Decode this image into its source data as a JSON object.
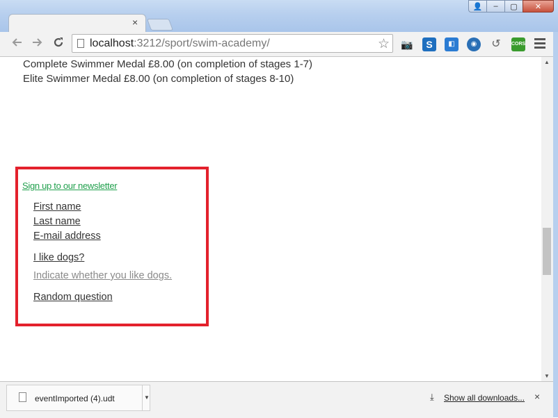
{
  "window": {
    "tab_close": "×",
    "controls": {
      "user": "👤",
      "minimize": "‒",
      "maximize": "▢",
      "close": "✕"
    }
  },
  "toolbar": {
    "back_icon": "back-arrow-icon",
    "forward_icon": "forward-arrow-icon",
    "reload_icon": "reload-icon",
    "url_host": "localhost",
    "url_rest": ":3212/sport/swim-academy/",
    "star": "☆",
    "extensions": [
      {
        "name": "camera-extension-icon",
        "color": "#333333",
        "glyph": "📷"
      },
      {
        "name": "s-extension-icon",
        "color": "#1f6fbf",
        "glyph": "S"
      },
      {
        "name": "tag-extension-icon",
        "color": "#2b7cd3",
        "glyph": "◧"
      },
      {
        "name": "globe-extension-icon",
        "color": "#2a6fb5",
        "glyph": "◉"
      },
      {
        "name": "history-extension-icon",
        "color": "#666666",
        "glyph": "↺"
      },
      {
        "name": "cors-extension-icon",
        "color": "#3a9b2e",
        "glyph": "CORS"
      }
    ]
  },
  "content": {
    "medals": [
      "Complete Swimmer Medal £8.00 (on completion of stages 1-7)",
      "Elite Swimmer Medal £8.00 (on completion of stages 8-10)"
    ],
    "newsletter_link": "Sign up to our newsletter",
    "form": {
      "first_name": "First name",
      "last_name": "Last name",
      "email": "E-mail address",
      "dogs_question": "I like dogs?",
      "dogs_hint": "Indicate whether you like dogs.",
      "random_question": "Random question"
    },
    "highlight_color": "#e3212c"
  },
  "downloads": {
    "file_name": "eventImported (4).udt",
    "show_all": "Show all downloads...",
    "close": "×"
  }
}
